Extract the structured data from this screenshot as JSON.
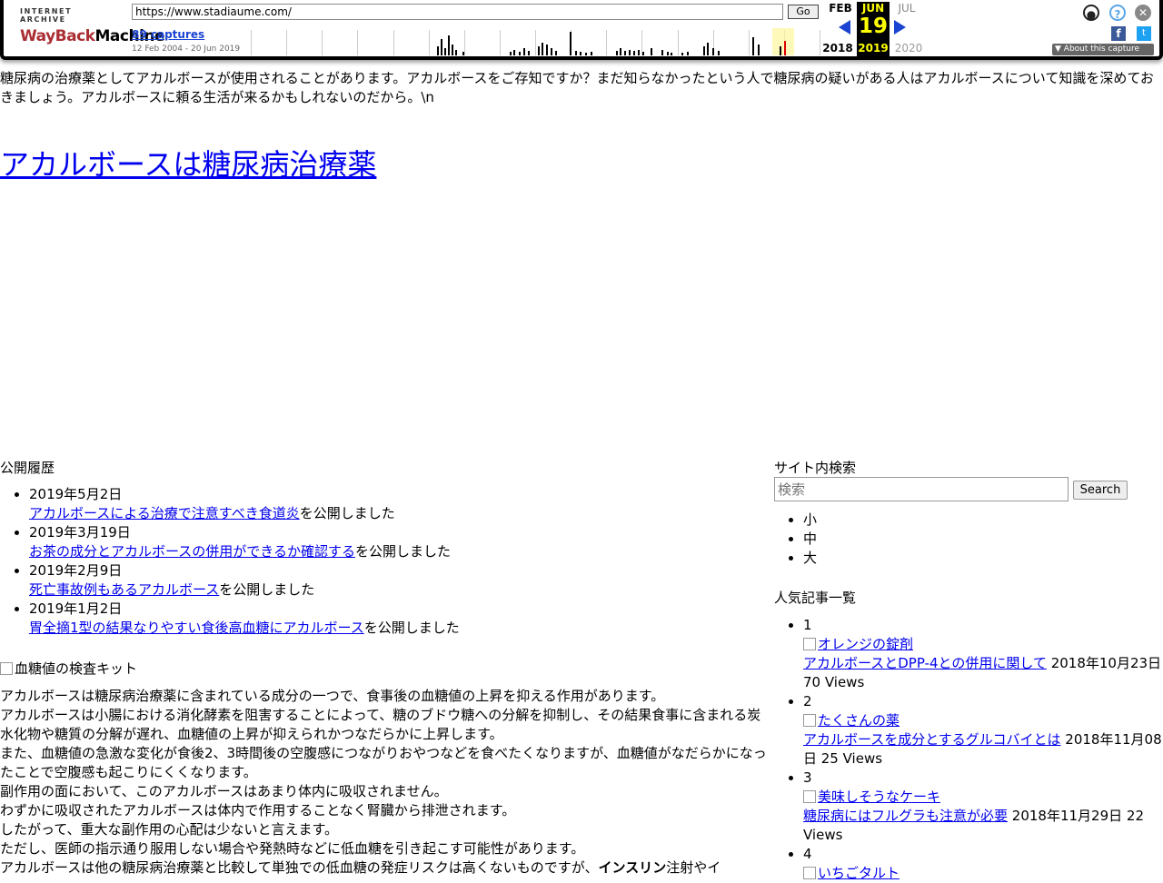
{
  "wayback": {
    "logo_top": "INTERNET ARCHIVE",
    "logo_wb": "WayBack",
    "logo_machine": "Machine",
    "url": "https://www.stadiaume.com/",
    "go_label": "Go",
    "captures_label": "89 captures",
    "range_label": "12 Feb 2004 - 20 Jun 2019",
    "prev_month": "FEB",
    "cur_month": "JUN",
    "next_month": "JUL",
    "cur_day": "19",
    "prev_year": "2018",
    "cur_year": "2019",
    "next_year": "2020",
    "about_label": "About this capture",
    "facebook_glyph": "f",
    "twitter_glyph": "t",
    "help_glyph": "?",
    "close_glyph": "✕",
    "user_glyph": "●"
  },
  "intro_text": "糖尿病の治療薬としてアカルボースが使用されることがあります。アカルボースをご存知ですか？まだ知らなかったという人で糖尿病の疑いがある人はアカルボースについて知識を深めておきましょう。アカルボースに頼る生活が来るかもしれないのだから。\\n",
  "site_title": "アカルボースは糖尿病治療薬",
  "history": {
    "heading": "公開履歴",
    "suffix": "を公開しました",
    "items": [
      {
        "date": "2019年5月2日",
        "title": "アカルボースによる治療で注意すべき食道炎"
      },
      {
        "date": "2019年3月19日",
        "title": "お茶の成分とアカルボースの併用ができるか確認する"
      },
      {
        "date": "2019年2月9日",
        "title": "死亡事故例もあるアカルボース"
      },
      {
        "date": "2019年1月2日",
        "title": "胃全摘1型の結果なりやすい食後高血糖にアカルボース"
      }
    ]
  },
  "hero_alt": "血糖値の検査キット",
  "article_lines": [
    "アカルボースは糖尿病治療薬に含まれている成分の一つで、食事後の血糖値の上昇を抑える作用があります。",
    "アカルボースは小腸における消化酵素を阻害することによって、糖のブドウ糖への分解を抑制し、その結果食事に含まれる炭水化物や糖質の分解が遅れ、血糖値の上昇が抑えられかつなだらかに上昇します。",
    "また、血糖値の急激な変化が食後2、3時間後の空腹感につながりおやつなどを食べたくなりますが、血糖値がなだらかになったことで空腹感も起こりにくくなります。",
    "副作用の面において、このアカルボースはあまり体内に吸収されません。",
    "わずかに吸収されたアカルボースは体内で作用することなく腎臓から排泄されます。",
    "したがって、重大な副作用の心配は少ないと言えます。",
    "ただし、医師の指示通り服用しない場合や発熱時などに低血糖を引き起こす可能性があります。"
  ],
  "article_last": {
    "before": "アカルボースは他の糖尿病治療薬と比較して単独での低血糖の発症リスクは高くないものですが、",
    "bold": "インスリン",
    "after": "注射やイ"
  },
  "sidebar": {
    "search_heading": "サイト内検索",
    "search_placeholder": "検索",
    "search_button": "Search",
    "font_sizes": [
      "小",
      "中",
      "大"
    ],
    "popular_heading": "人気記事一覧",
    "popular": [
      {
        "rank": "1",
        "image_alt": "オレンジの錠剤",
        "title": "アカルボースとDPP-4との併用に関して",
        "meta": " 2018年10月23日 70 Views"
      },
      {
        "rank": "2",
        "image_alt": "たくさんの薬",
        "title": "アカルボースを成分とするグルコバイとは",
        "meta": " 2018年11月08日 25 Views"
      },
      {
        "rank": "3",
        "image_alt": "美味しそうなケーキ",
        "title": "糖尿病にはフルグラも注意が必要",
        "meta": " 2018年11月29日 22 Views"
      },
      {
        "rank": "4",
        "image_alt": "いちごタルト",
        "title": "",
        "meta": ""
      }
    ]
  }
}
